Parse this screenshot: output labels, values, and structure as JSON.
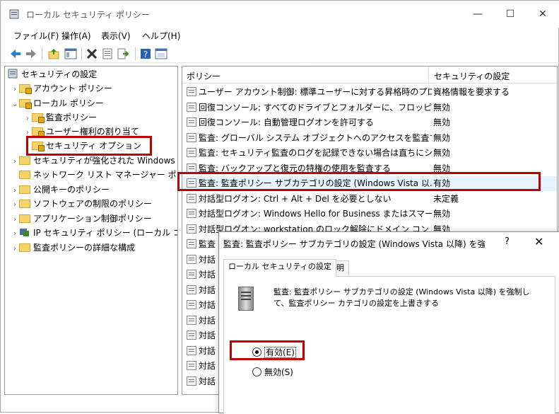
{
  "window": {
    "title": "ローカル セキュリティ ポリシー",
    "minimize": "—",
    "maximize": "☐",
    "close": "✕"
  },
  "menu": [
    {
      "label": "ファイル(F)"
    },
    {
      "label": "操作(A)"
    },
    {
      "label": "表示(V)"
    },
    {
      "label": "ヘルプ(H)"
    }
  ],
  "toolbar": {
    "icons": [
      "back-arrow-icon",
      "forward-arrow-icon",
      "up-folder-icon",
      "show-hide-tree-icon",
      "delete-icon",
      "properties-icon",
      "export-list-icon",
      "help-icon",
      "console-icon"
    ]
  },
  "tree": {
    "root": "セキュリティの設定",
    "items": [
      {
        "label": "アカウント ポリシー"
      },
      {
        "label": "ローカル ポリシー"
      },
      {
        "label": "監査ポリシー"
      },
      {
        "label": "ユーザー権利の割り当て"
      },
      {
        "label": "セキュリティ オプション"
      },
      {
        "label": "セキュリティが強化された Windows De"
      },
      {
        "label": "ネットワーク リスト マネージャー ポリシー"
      },
      {
        "label": "公開キーのポリシー"
      },
      {
        "label": "ソフトウェアの制限のポリシー"
      },
      {
        "label": "アプリケーション制御ポリシー"
      },
      {
        "label": "IP セキュリティ ポリシー (ローカル コンピュ"
      },
      {
        "label": "監査ポリシーの詳細な構成"
      }
    ]
  },
  "list": {
    "col_policy": "ポリシー",
    "col_setting": "セキュリティの設定",
    "rows": [
      {
        "policy": "ユーザー アカウント制御: 標準ユーザーに対する昇格時のプロン...",
        "setting": "資格情報を要求する"
      },
      {
        "policy": "回復コンソール: すべてのドライブとフォルダーに、フロッピーのコピ...",
        "setting": "無効"
      },
      {
        "policy": "回復コンソール: 自動管理ログオンを許可する",
        "setting": "無効"
      },
      {
        "policy": "監査: グローバル システム オブジェクトへのアクセスを監査する",
        "setting": "無効"
      },
      {
        "policy": "監査: セキュリティ監査のログを記録できない場合は直ちにシス...",
        "setting": "無効"
      },
      {
        "policy": "監査: バックアップと復元の特権の使用を監査する",
        "setting": "無効"
      },
      {
        "policy": "監査: 監査ポリシー サブカテゴリの設定 (Windows Vista 以...",
        "setting": "有効"
      },
      {
        "policy": "対話型ログオン: Ctrl + Alt + Del を必要としない",
        "setting": "未定義"
      },
      {
        "policy": "対話型ログオン: Windows Hello for Business またはスマー...",
        "setting": "無効"
      },
      {
        "policy": "対話型ログオン: workstation のロック解除にドメイン コントロー...",
        "setting": "無効"
      },
      {
        "policy": "監査",
        "setting": ""
      },
      {
        "policy": "対話",
        "setting": ""
      },
      {
        "policy": "対話",
        "setting": ""
      },
      {
        "policy": "対話",
        "setting": ""
      },
      {
        "policy": "対話",
        "setting": ""
      },
      {
        "policy": "対話",
        "setting": ""
      },
      {
        "policy": "対話",
        "setting": ""
      },
      {
        "policy": "対話",
        "setting": ""
      },
      {
        "policy": "対話",
        "setting": ""
      },
      {
        "policy": "対話",
        "setting": ""
      }
    ]
  },
  "dialog": {
    "title": "監査: 監査ポリシー サブカテゴリの設定 (Windows Vista 以降) を強制...",
    "help": "?",
    "close": "✕",
    "tab_local": "ローカル セキュリティの設定",
    "tab_explain": "説明",
    "description": "監査: 監査ポリシー サブカテゴリの設定 (Windows Vista 以降) を強制して、監査ポリシー カテゴリの設定を上書きする",
    "enabled_label": "有効(E)",
    "disabled_label": "無効(S)",
    "selected": "enabled"
  }
}
